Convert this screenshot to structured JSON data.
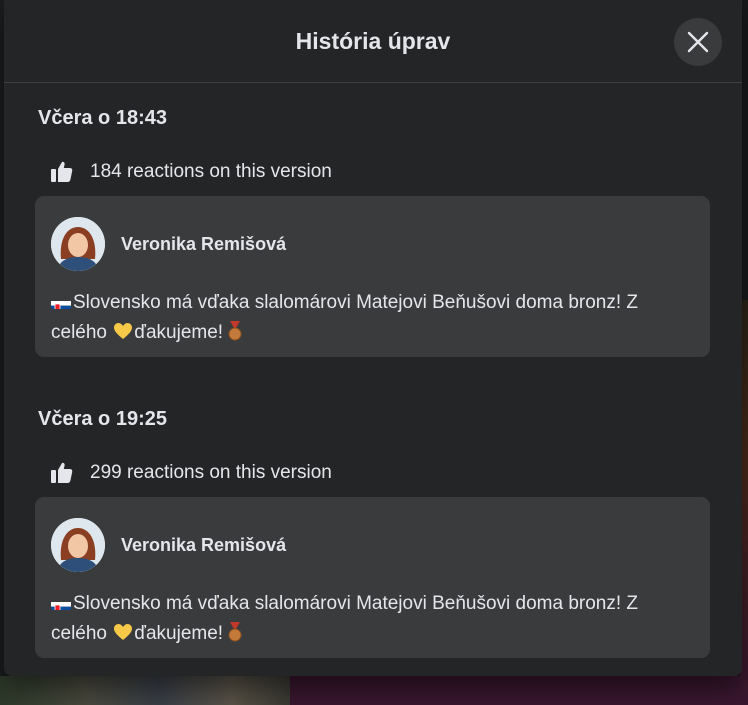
{
  "modal": {
    "title": "História úprav"
  },
  "versions": [
    {
      "date": "Včera o 18:43",
      "reactions": "184 reactions on this version",
      "author": "Veronika Remišová",
      "text_line1": "Slovensko má vďaka slalomárovi Matejovi Beňušovi doma bronz! Z",
      "text_line2_a": "celého ",
      "text_line2_b": "ďakujeme!"
    },
    {
      "date": "Včera o 19:25",
      "reactions": "299 reactions on this version",
      "author": "Veronika Remišová",
      "text_line1": "Slovensko má vďaka slalomárovi Matejovi Beňušovi doma bronz! Z",
      "text_line2_a": "celého ",
      "text_line2_b": "ďakujeme!"
    }
  ],
  "icons": {
    "close": "close-icon",
    "like": "thumbs-up-icon",
    "flag": "slovakia-flag-emoji",
    "heart": "yellow-heart-emoji",
    "medal": "bronze-medal-emoji"
  },
  "colors": {
    "modal_bg": "#242526",
    "card_bg": "#3a3b3c",
    "text": "#e4e6eb",
    "heart": "#f7c948",
    "medal": "#c47a3a"
  }
}
